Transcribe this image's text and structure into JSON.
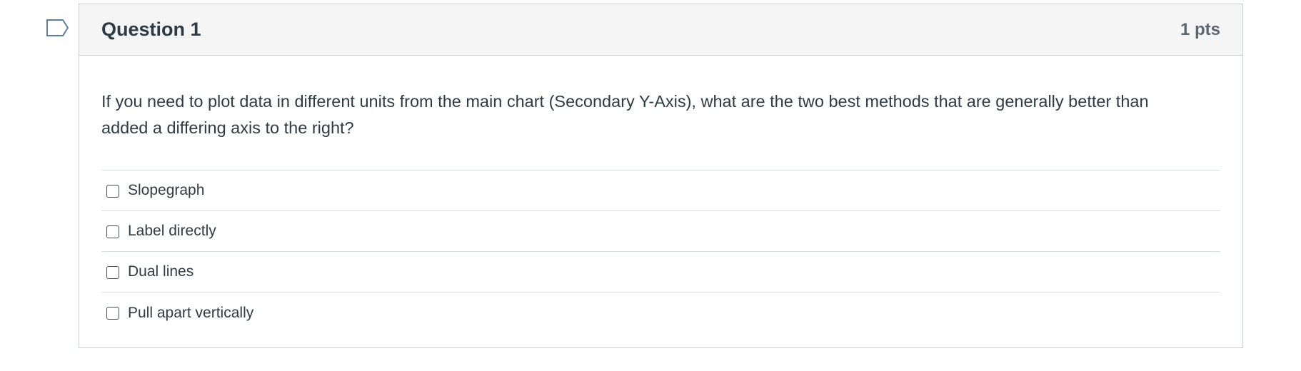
{
  "question": {
    "title": "Question 1",
    "points": "1 pts",
    "text": "If you need to plot data in different units from the main chart (Secondary Y-Axis), what are the two best methods that are generally better than added a differing axis to the right?",
    "answers": [
      {
        "label": "Slopegraph",
        "checked": false
      },
      {
        "label": "Label directly",
        "checked": false
      },
      {
        "label": "Dual lines",
        "checked": false
      },
      {
        "label": "Pull apart vertically",
        "checked": false
      }
    ]
  },
  "icons": {
    "flag": "flag-outline-icon"
  },
  "colors": {
    "header_bg": "#f5f5f5",
    "text": "#2d3b45",
    "border": "#c7cdd1",
    "flag": "#5a7ea6"
  }
}
